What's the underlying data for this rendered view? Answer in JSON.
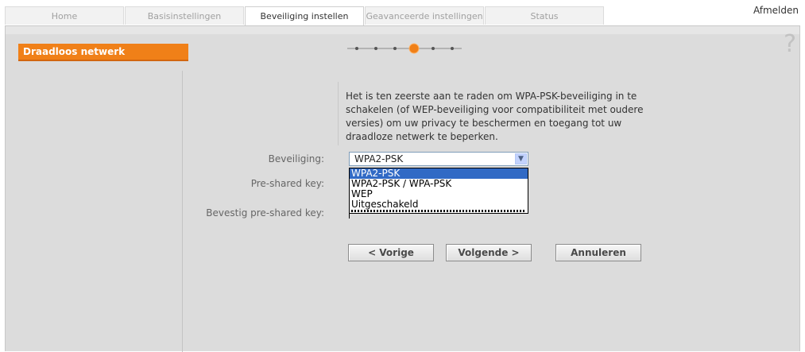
{
  "tabs": [
    {
      "label": "Home",
      "active": false
    },
    {
      "label": "Basisinstellingen",
      "active": false
    },
    {
      "label": "Beveiliging instellen",
      "active": true
    },
    {
      "label": "Geavanceerde instellingen",
      "active": false
    },
    {
      "label": "Status",
      "active": false
    }
  ],
  "header": {
    "logout_label": "Afmelden"
  },
  "sidebar": {
    "items": [
      {
        "label": "Draadloos netwerk",
        "active": true
      }
    ]
  },
  "help": {
    "symbol": "?"
  },
  "wizard": {
    "total_steps": 6,
    "current_step": 4
  },
  "intro_text": "Het is ten zeerste aan te raden om WPA-PSK-beveiliging in te schakelen (of WEP-beveiliging voor compatibiliteit met oudere versies) om uw privacy te beschermen en toegang tot uw draadloze netwerk te beperken.",
  "form": {
    "security_label": "Beveiliging:",
    "security_value": "WPA2-PSK",
    "security_options": [
      "WPA2-PSK",
      "WPA2-PSK / WPA-PSK",
      "WEP",
      "Uitgeschakeld"
    ],
    "psk_label": "Pre-shared key:",
    "confirm_psk_label": "Bevestig pre-shared key:"
  },
  "buttons": {
    "prev": "< Vorige",
    "next": "Volgende >",
    "cancel": "Annuleren"
  },
  "colors": {
    "accent": "#f08018",
    "selection": "#316ac5",
    "panel": "#dcdcdc"
  },
  "icons": {
    "help": "question-mark-icon",
    "dropdown": "chevron-down-icon"
  }
}
